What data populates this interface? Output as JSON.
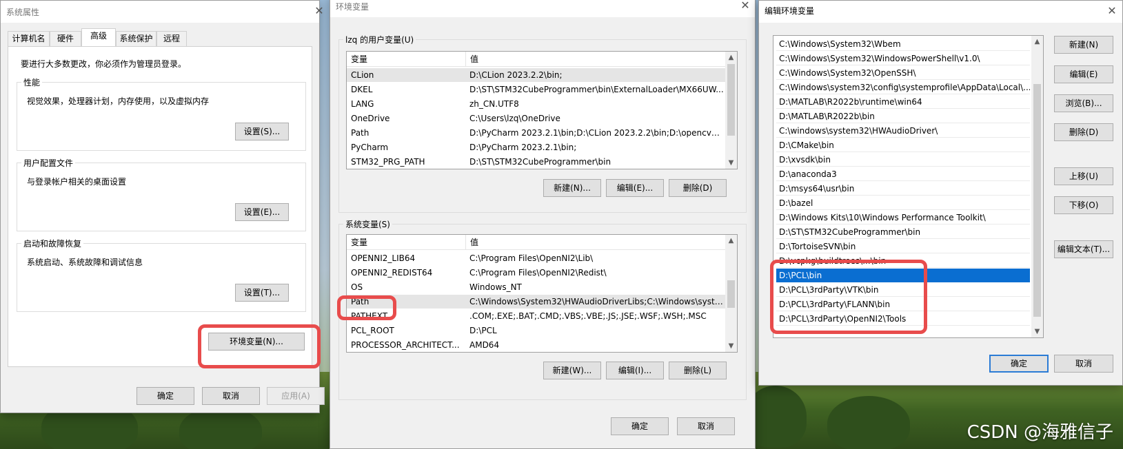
{
  "sys_props": {
    "title": "系统属性",
    "tabs": [
      "计算机名",
      "硬件",
      "高级",
      "系统保护",
      "远程"
    ],
    "admin_note": "要进行大多数更改，你必须作为管理员登录。",
    "perf": {
      "label": "性能",
      "desc": "视觉效果，处理器计划，内存使用，以及虚拟内存",
      "button": "设置(S)..."
    },
    "profile": {
      "label": "用户配置文件",
      "desc": "与登录帐户相关的桌面设置",
      "button": "设置(E)..."
    },
    "startup": {
      "label": "启动和故障恢复",
      "desc": "系统启动、系统故障和调试信息",
      "button": "设置(T)..."
    },
    "env_button": "环境变量(N)...",
    "ok": "确定",
    "cancel": "取消",
    "apply": "应用(A)"
  },
  "env_vars": {
    "title": "环境变量",
    "user_label": "lzq 的用户变量(U)",
    "col_var": "变量",
    "col_val": "值",
    "user_rows": [
      {
        "name": "CLion",
        "value": "D:\\CLion 2023.2.2\\bin;"
      },
      {
        "name": "DKEL",
        "value": "D:\\ST\\STM32CubeProgrammer\\bin\\ExternalLoader\\MX66UW..."
      },
      {
        "name": "LANG",
        "value": "zh_CN.UTF8"
      },
      {
        "name": "OneDrive",
        "value": "C:\\Users\\lzq\\OneDrive"
      },
      {
        "name": "Path",
        "value": "D:\\PyCharm 2023.2.1\\bin;D:\\CLion 2023.2.2\\bin;D:\\opencv4.6...."
      },
      {
        "name": "PyCharm",
        "value": "D:\\PyCharm 2023.2.1\\bin;"
      },
      {
        "name": "STM32_PRG_PATH",
        "value": "D:\\ST\\STM32CubeProgrammer\\bin"
      }
    ],
    "user_buttons": {
      "new": "新建(N)...",
      "edit": "编辑(E)...",
      "delete": "删除(D)"
    },
    "sys_label": "系统变量(S)",
    "sys_rows": [
      {
        "name": "OPENNI2_LIB64",
        "value": "C:\\Program Files\\OpenNI2\\Lib\\"
      },
      {
        "name": "OPENNI2_REDIST64",
        "value": "C:\\Program Files\\OpenNI2\\Redist\\"
      },
      {
        "name": "OS",
        "value": "Windows_NT"
      },
      {
        "name": "Path",
        "value": "C:\\Windows\\System32\\HWAudioDriverLibs;C:\\Windows\\syste..."
      },
      {
        "name": "PATHEXT",
        "value": ".COM;.EXE;.BAT;.CMD;.VBS;.VBE;.JS;.JSE;.WSF;.WSH;.MSC"
      },
      {
        "name": "PCL_ROOT",
        "value": "D:\\PCL"
      },
      {
        "name": "PROCESSOR_ARCHITECT...",
        "value": "AMD64"
      }
    ],
    "sys_buttons": {
      "new": "新建(W)...",
      "edit": "编辑(I)...",
      "delete": "删除(L)"
    },
    "ok": "确定",
    "cancel": "取消"
  },
  "edit_env": {
    "title": "编辑环境变量",
    "paths": [
      "C:\\Windows\\System32\\Wbem",
      "C:\\Windows\\System32\\WindowsPowerShell\\v1.0\\",
      "C:\\Windows\\System32\\OpenSSH\\",
      "C:\\Windows\\system32\\config\\systemprofile\\AppData\\Local\\...",
      "D:\\MATLAB\\R2022b\\runtime\\win64",
      "D:\\MATLAB\\R2022b\\bin",
      "C:\\windows\\system32\\HWAudioDriver\\",
      "D:\\CMake\\bin",
      "D:\\xvsdk\\bin",
      "D:\\anaconda3",
      "D:\\msys64\\usr\\bin",
      "D:\\bazel",
      "D:\\Windows Kits\\10\\Windows Performance Toolkit\\",
      "D:\\ST\\STM32CubeProgrammer\\bin",
      "D:\\TortoiseSVN\\bin",
      "D:\\vcpkg\\buildtrees\\...\\bin",
      "D:\\PCL\\bin",
      "D:\\PCL\\3rdParty\\VTK\\bin",
      "D:\\PCL\\3rdParty\\FLANN\\bin",
      "D:\\PCL\\3rdParty\\OpenNI2\\Tools"
    ],
    "buttons": {
      "new": "新建(N)",
      "edit": "编辑(E)",
      "browse": "浏览(B)...",
      "delete": "删除(D)",
      "up": "上移(U)",
      "down": "下移(O)",
      "edit_text": "编辑文本(T)..."
    },
    "ok": "确定",
    "cancel": "取消"
  },
  "watermark": "CSDN @海雅信子",
  "colors": {
    "highlight": "#e84c4c",
    "selection": "#0a6ed1"
  }
}
